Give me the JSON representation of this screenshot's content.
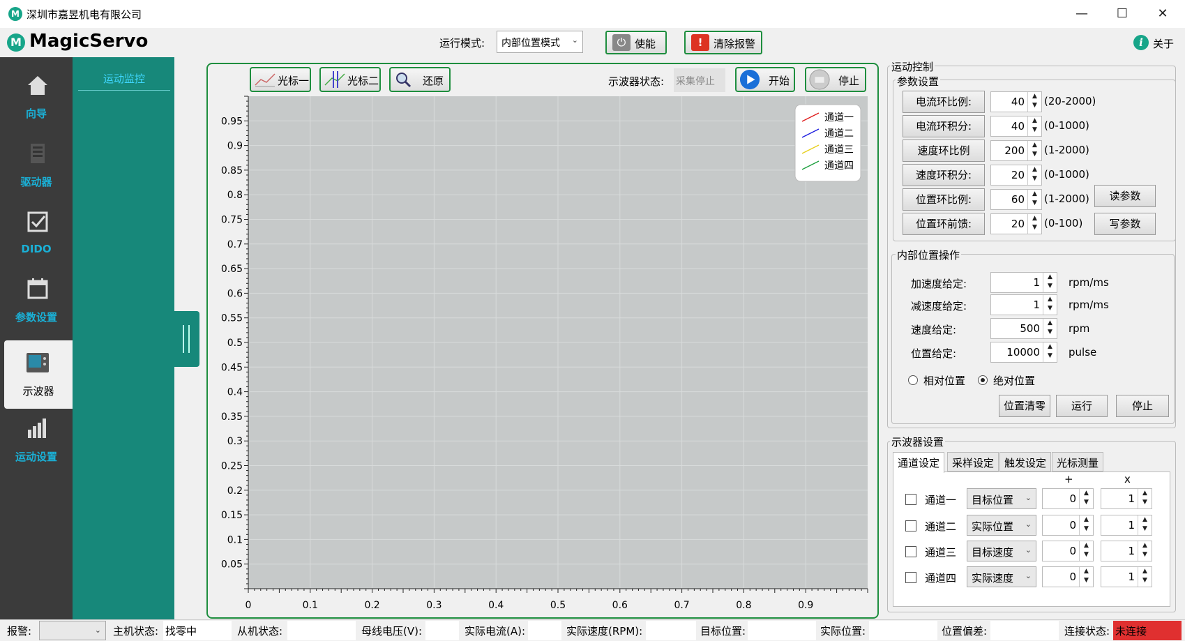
{
  "window": {
    "title": "深圳市嘉昱机电有限公司",
    "logo_letter": "M"
  },
  "header": {
    "app_name": "MagicServo",
    "mode_label": "运行模式:",
    "mode_value": "内部位置模式",
    "enable_label": "使能",
    "clear_alarm_label": "清除报警",
    "about_label": "关于"
  },
  "nav": {
    "items": [
      {
        "label": "向导"
      },
      {
        "label": "驱动器"
      },
      {
        "label": "DIDO"
      },
      {
        "label": "参数设置"
      },
      {
        "label": "示波器"
      },
      {
        "label": "运动设置"
      }
    ],
    "sub_item": "运动监控"
  },
  "scope": {
    "cursor1_label": "光标一",
    "cursor2_label": "光标二",
    "restore_label": "还原",
    "state_label": "示波器状态:",
    "state_value": "采集停止",
    "start_label": "开始",
    "stop_label": "停止"
  },
  "chart_data": {
    "type": "line",
    "y_ticks": [
      "0.95",
      "0.9",
      "0.85",
      "0.8",
      "0.75",
      "0.7",
      "0.65",
      "0.6",
      "0.55",
      "0.5",
      "0.45",
      "0.4",
      "0.35",
      "0.3",
      "0.25",
      "0.2",
      "0.15",
      "0.1",
      "0.05"
    ],
    "x_ticks": [
      "0",
      "0.1",
      "0.2",
      "0.3",
      "0.4",
      "0.5",
      "0.6",
      "0.7",
      "0.8",
      "0.9"
    ],
    "xlim": [
      0,
      1
    ],
    "ylim": [
      0,
      1
    ],
    "grid": true,
    "legend_position": "top-right",
    "series": [
      {
        "name": "通道一",
        "color": "#e02020",
        "values": []
      },
      {
        "name": "通道二",
        "color": "#2020e0",
        "values": []
      },
      {
        "name": "通道三",
        "color": "#e8d020",
        "values": []
      },
      {
        "name": "通道四",
        "color": "#20a040",
        "values": []
      }
    ],
    "plot_bg": "#c6c9c9"
  },
  "motion": {
    "title": "运动控制",
    "params_title": "参数设置",
    "params": [
      {
        "label": "电流环比例:",
        "value": "40",
        "range": "(20-2000)"
      },
      {
        "label": "电流环积分:",
        "value": "40",
        "range": "(0-1000)"
      },
      {
        "label": "速度环比例",
        "value": "200",
        "range": "(1-2000)"
      },
      {
        "label": "速度环积分:",
        "value": "20",
        "range": "(0-1000)"
      },
      {
        "label": "位置环比例:",
        "value": "60",
        "range": "(1-2000)"
      },
      {
        "label": "位置环前馈:",
        "value": "20",
        "range": "(0-100)"
      }
    ],
    "read_params": "读参数",
    "write_params": "写参数",
    "internal_title": "内部位置操作",
    "internal": [
      {
        "label": "加速度给定:",
        "value": "1",
        "unit": "rpm/ms"
      },
      {
        "label": "减速度给定:",
        "value": "1",
        "unit": "rpm/ms"
      },
      {
        "label": "速度给定:",
        "value": "500",
        "unit": "rpm"
      },
      {
        "label": "位置给定:",
        "value": "10000",
        "unit": "pulse"
      }
    ],
    "relative": "相对位置",
    "absolute": "绝对位置",
    "pos_clear": "位置清零",
    "run": "运行",
    "stop": "停止"
  },
  "scope_settings": {
    "title": "示波器设置",
    "tabs": [
      "通道设定",
      "采样设定",
      "触发设定",
      "光标测量"
    ],
    "col_plus": "+",
    "col_x": "x",
    "channels": [
      {
        "name": "通道一",
        "source": "目标位置",
        "offset": "0",
        "scale": "1"
      },
      {
        "name": "通道二",
        "source": "实际位置",
        "offset": "0",
        "scale": "1"
      },
      {
        "name": "通道三",
        "source": "目标速度",
        "offset": "0",
        "scale": "1"
      },
      {
        "name": "通道四",
        "source": "实际速度",
        "offset": "0",
        "scale": "1"
      }
    ]
  },
  "status": {
    "alarm_label": "报警:",
    "host_label": "主机状态:",
    "host_value": "找零中",
    "slave_label": "从机状态:",
    "bus_label": "母线电压(V):",
    "current_label": "实际电流(A):",
    "speed_label": "实际速度(RPM):",
    "target_label": "目标位置:",
    "actual_label": "实际位置:",
    "dev_label": "位置偏差:",
    "conn_label": "连接状态:",
    "conn_value": "未连接",
    "conn_color": "#e03030"
  }
}
